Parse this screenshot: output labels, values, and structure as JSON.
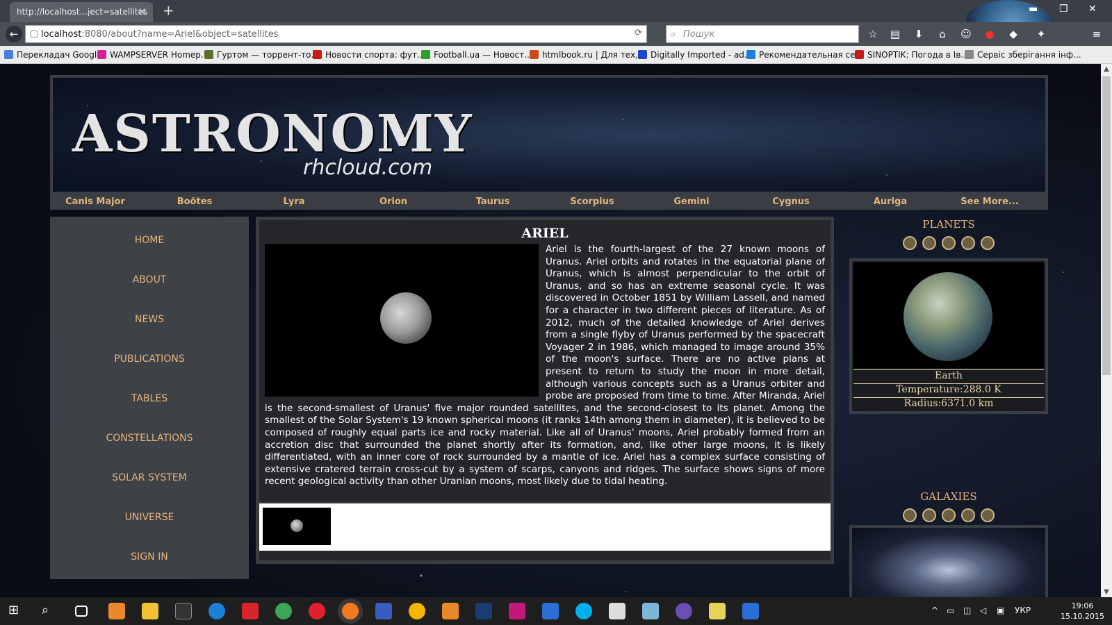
{
  "browser": {
    "tab_title": "http://localhost...ject=satellites",
    "tab_close": "✕",
    "new_tab": "+",
    "url_host": "localhost",
    "url_rest": ":8080/about?name=Ariel&object=satellites",
    "search_placeholder": "Пошук",
    "bookmarks": [
      {
        "label": "Перекладач Google",
        "color": "#4a7fe0"
      },
      {
        "label": "WAMPSERVER Homep...",
        "color": "#d6209a"
      },
      {
        "label": "Гуртом — торрент-то...",
        "color": "#5b6e2e"
      },
      {
        "label": "Новости спорта: фут...",
        "color": "#c91a1a"
      },
      {
        "label": "Football.ua — Новост...",
        "color": "#2aa12a"
      },
      {
        "label": "htmlbook.ru | Для тех,...",
        "color": "#c94a1a"
      },
      {
        "label": "Digitally Imported - ad...",
        "color": "#1a4ac9"
      },
      {
        "label": "Рекомендательная се...",
        "color": "#1a7fe0"
      },
      {
        "label": "SINOPTIK: Погода в Ів...",
        "color": "#c91a1a"
      },
      {
        "label": "Сервіс зберігання інф...",
        "color": "#888888"
      }
    ]
  },
  "header": {
    "logo": "ASTRONOMY",
    "subtitle": "rhcloud.com"
  },
  "constellations": [
    "Canis Major",
    "Boötes",
    "Lyra",
    "Orion",
    "Taurus",
    "Scorpius",
    "Gemini",
    "Cygnus",
    "Auriga",
    "See More..."
  ],
  "sidebar": {
    "items": [
      "HOME",
      "ABOUT",
      "NEWS",
      "PUBLICATIONS",
      "TABLES",
      "CONSTELLATIONS",
      "SOLAR SYSTEM",
      "UNIVERSE",
      "SIGN IN"
    ]
  },
  "article": {
    "title": "ARIEL",
    "text": "Ariel is the fourth-largest of the 27 known moons of Uranus. Ariel orbits and rotates in the equatorial plane of Uranus, which is almost perpendicular to the orbit of Uranus, and so has an extreme seasonal cycle. It was discovered in October 1851 by William Lassell, and named for a character in two different pieces of literature. As of 2012, much of the detailed knowledge of Ariel derives from a single flyby of Uranus performed by the spacecraft Voyager 2 in 1986, which managed to image around 35% of the moon's surface. There are no active plans at present to return to study the moon in more detail, although various concepts such as a Uranus orbiter and probe are proposed from time to time. After Miranda, Ariel is the second-smallest of Uranus' five major rounded satellites, and the second-closest to its planet. Among the smallest of the Solar System's 19 known spherical moons (it ranks 14th among them in diameter), it is believed to be composed of roughly equal parts ice and rocky material. Like all of Uranus' moons, Ariel probably formed from an accretion disc that surrounded the planet shortly after its formation, and, like other large moons, it is likely differentiated, with an inner core of rock surrounded by a mantle of ice. Ariel has a complex surface consisting of extensive cratered terrain cross-cut by a system of scarps, canyons and ridges. The surface shows signs of more recent geological activity than other Uranian moons, most likely due to tidal heating."
  },
  "planets": {
    "title": "PLANETS",
    "name": "Earth",
    "temperature": "Temperature:288.0 K",
    "radius": "Radius:6371.0 km"
  },
  "galaxies": {
    "title": "GALAXIES"
  },
  "taskbar": {
    "lang": "УКР",
    "time": "19:06",
    "date": "15.10.2015"
  }
}
